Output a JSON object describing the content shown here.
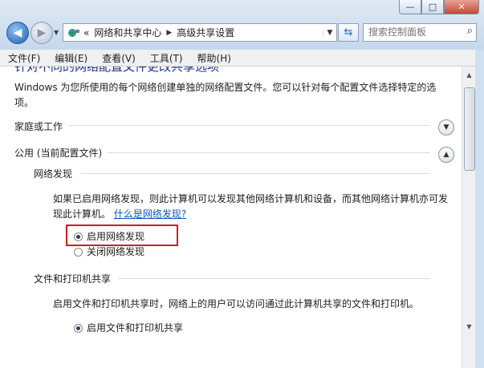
{
  "window": {
    "minimize_glyph": "—",
    "maximize_glyph": "□",
    "close_glyph": "✕"
  },
  "nav": {
    "back_glyph": "◀",
    "forward_glyph": "▶",
    "history_glyph": "▼"
  },
  "address": {
    "icon": "network-icon",
    "chevrons": "«",
    "crumbs": [
      "网络和共享中心",
      "高级共享设置"
    ],
    "separator": "▶",
    "dropdown_glyph": "▼"
  },
  "search": {
    "placeholder": "搜索控制面板",
    "icon": "search-icon"
  },
  "menu": [
    "文件(F)",
    "编辑(E)",
    "查看(V)",
    "工具(T)",
    "帮助(H)"
  ],
  "content": {
    "heading": "针对不同的网络配置文件更改共享选项",
    "description_line1": "Windows 为您所使用的每个网络创建单独的网络配置文件。您可以针对每个配置文件选择特定的选",
    "description_line2": "项。",
    "profiles": [
      {
        "label": "家庭或工作",
        "toggle": "expand"
      },
      {
        "label": "公用 (当前配置文件)",
        "toggle": "collapse"
      }
    ],
    "network_discovery": {
      "title": "网络发现",
      "text_line1": "如果已启用网络发现，则此计算机可以发现其他网络计算机和设备，而其他网络计算机亦可发",
      "text_line2_prefix": "现此计算机。",
      "help_link": "什么是网络发现?",
      "options": [
        {
          "label": "启用网络发现",
          "selected": true
        },
        {
          "label": "关闭网络发现",
          "selected": false
        }
      ]
    },
    "file_printer_sharing": {
      "title": "文件和打印机共享",
      "text": "启用文件和打印机共享时，网络上的用户可以访问通过此计算机共享的文件和打印机。",
      "options": [
        {
          "label": "启用文件和打印机共享",
          "selected": true
        }
      ]
    }
  },
  "scrollbar": {
    "up_glyph": "▲",
    "down_glyph": "▼"
  },
  "colors": {
    "highlight_box": "#cc1f1f",
    "link": "#0a58c0",
    "heading": "#1e3287"
  }
}
